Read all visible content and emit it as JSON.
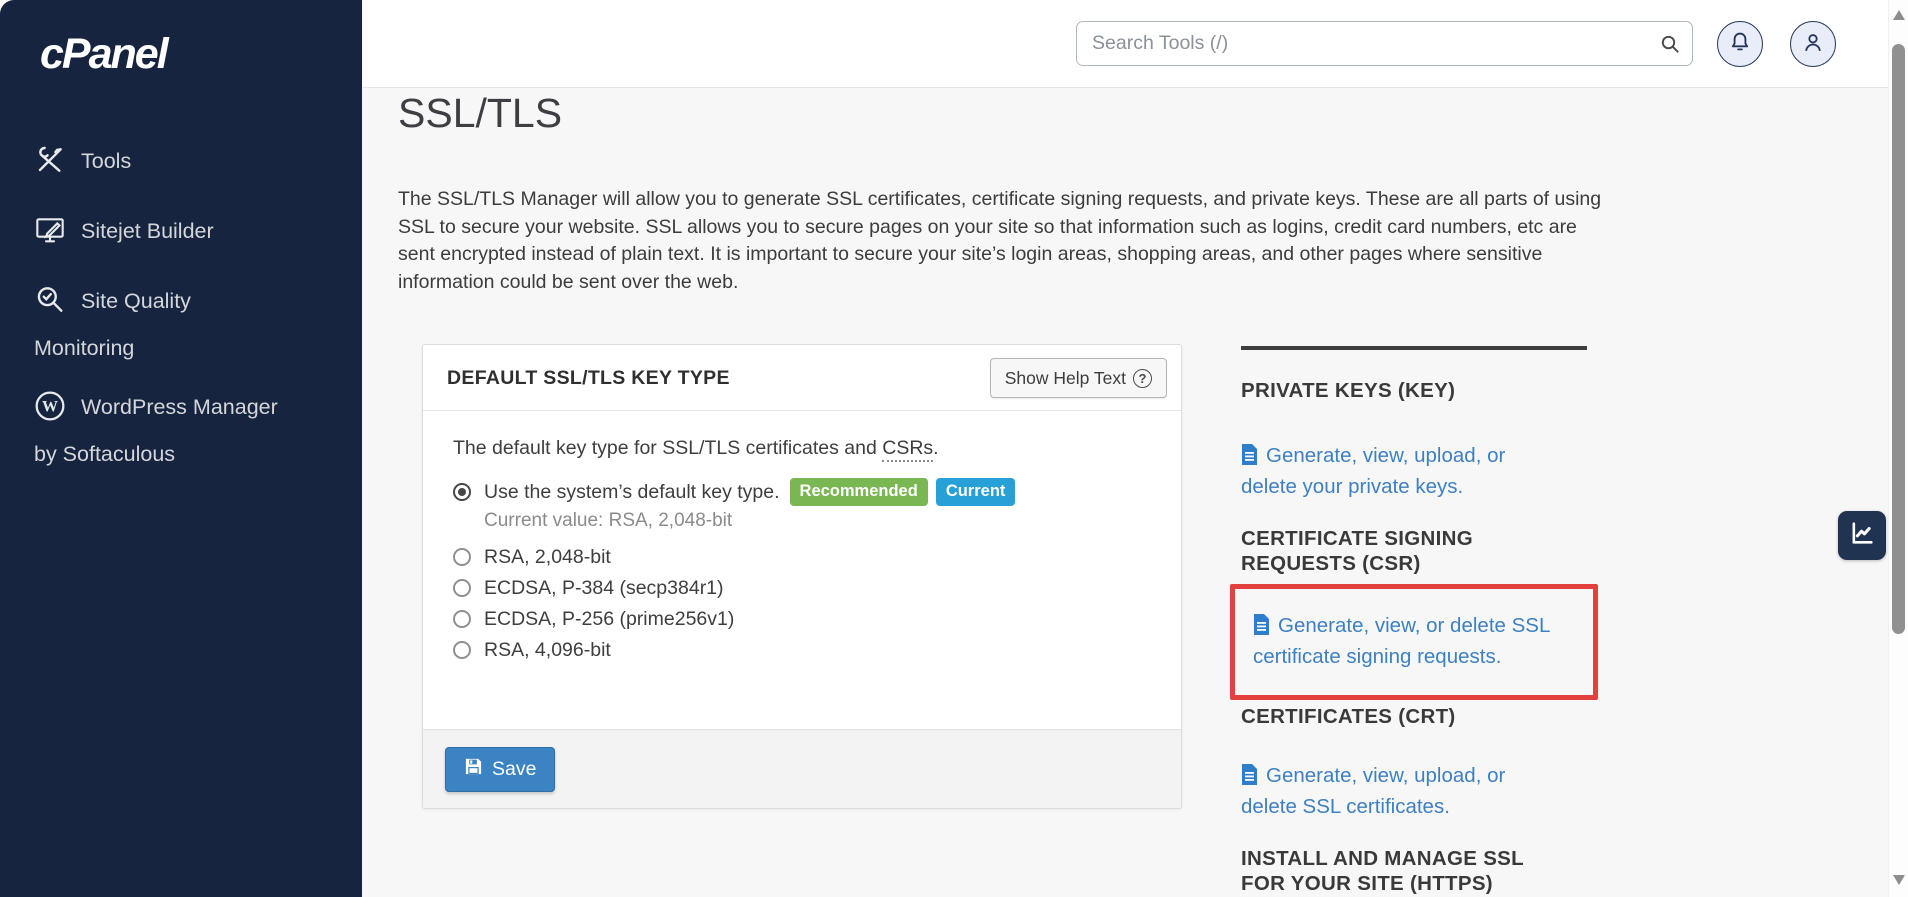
{
  "sidebar": {
    "logo": "cPanel",
    "items": [
      {
        "label": "Tools"
      },
      {
        "label": "Sitejet Builder"
      },
      {
        "label": "Site Quality",
        "label2": "Monitoring"
      },
      {
        "label": "WordPress Manager",
        "label2": "by Softaculous"
      }
    ]
  },
  "topbar": {
    "search_placeholder": "Search Tools (/)"
  },
  "page": {
    "title": "SSL/TLS",
    "description": "The SSL/TLS Manager will allow you to generate SSL certificates, certificate signing requests, and private keys. These are all parts of using SSL to secure your website. SSL allows you to secure pages on your site so that information such as logins, credit card numbers, etc are sent encrypted instead of plain text. It is important to secure your site’s login areas, shopping areas, and other pages where sensitive information could be sent over the web."
  },
  "key_type_panel": {
    "title": "DEFAULT SSL/TLS KEY TYPE",
    "help_button": "Show Help Text",
    "intro_prefix": "The default key type for SSL/TLS certificates and ",
    "intro_term": "CSRs",
    "intro_suffix": ".",
    "options": [
      {
        "label": "Use the system’s default key type.",
        "selected": true
      },
      {
        "label": "RSA, 2,048-bit"
      },
      {
        "label": "ECDSA, P-384 (secp384r1)"
      },
      {
        "label": "ECDSA, P-256 (prime256v1)"
      },
      {
        "label": "RSA, 4,096-bit"
      }
    ],
    "badges": {
      "recommended": "Recommended",
      "current": "Current"
    },
    "current_value": "Current value: RSA, 2,048-bit",
    "save_label": "Save"
  },
  "shortcuts": {
    "sections": [
      {
        "heading": "PRIVATE KEYS (KEY)",
        "link": "Generate, view, upload, or delete your private keys."
      },
      {
        "heading": "CERTIFICATE SIGNING REQUESTS (CSR)",
        "link": "Generate, view, or delete SSL certificate signing requests.",
        "highlighted": true
      },
      {
        "heading": "CERTIFICATES (CRT)",
        "link": "Generate, view, upload, or delete SSL certificates."
      },
      {
        "heading": "INSTALL AND MANAGE SSL FOR YOUR SITE (HTTPS)"
      }
    ]
  },
  "colors": {
    "sidebar_bg": "#16243f",
    "link_blue": "#3e80c0",
    "badge_green": "#79b752",
    "badge_blue": "#27a0d8",
    "save_blue": "#3c83c3",
    "highlight_red": "#e2413d"
  }
}
